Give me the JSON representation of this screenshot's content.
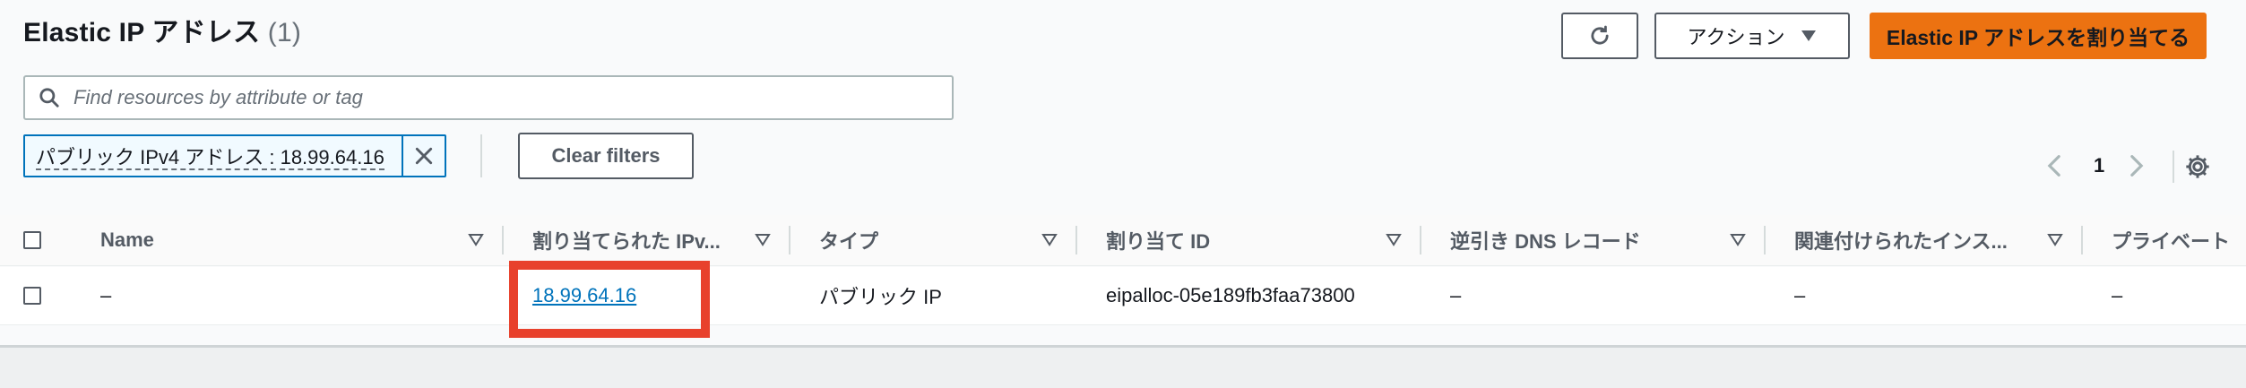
{
  "header": {
    "title": "Elastic IP アドレス",
    "count": "(1)",
    "actions_label": "アクション",
    "allocate_label": "Elastic IP アドレスを割り当てる"
  },
  "search": {
    "placeholder": "Find resources by attribute or tag"
  },
  "filter": {
    "token_label": "パブリック IPv4 アドレス : 18.99.64.16",
    "clear_label": "Clear filters"
  },
  "pagination": {
    "current_page": "1"
  },
  "table": {
    "columns": [
      "Name",
      "割り当てられた IPv...",
      "タイプ",
      "割り当て ID",
      "逆引き DNS レコード",
      "関連付けられたインス...",
      "プライベート"
    ],
    "rows": [
      {
        "name": "–",
        "ip": "18.99.64.16",
        "type": "パブリック IP",
        "allocation_id": "eipalloc-05e189fb3faa73800",
        "reverse_dns": "–",
        "instance": "–",
        "private": "–"
      }
    ]
  },
  "colors": {
    "primary": "#ec7211",
    "link": "#0073bb",
    "highlight": "#e8412c"
  }
}
